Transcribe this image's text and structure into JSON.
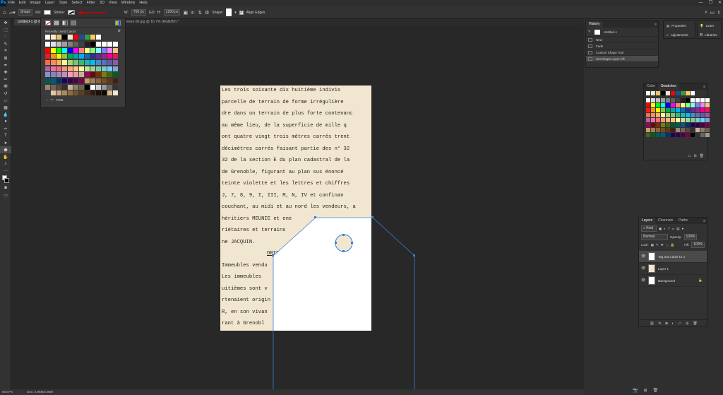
{
  "app": {
    "logo": "Ps"
  },
  "menu": [
    "File",
    "Edit",
    "Image",
    "Layer",
    "Type",
    "Select",
    "Filter",
    "3D",
    "View",
    "Window",
    "Help"
  ],
  "window_controls": [
    "—",
    "❐",
    "✕"
  ],
  "options": {
    "mode": "Shape",
    "fill_label": "Fill:",
    "stroke_label": "Stroke:",
    "w_label": "W:",
    "w_value": "750 px",
    "go_label": "GO",
    "h_label": "H:",
    "h_value": "1250 px",
    "shape_label": "Shape:",
    "align_edges": "Align Edges"
  },
  "tabs": [
    {
      "label": "Untitled-1 @ 66.7",
      "active": true
    },
    {
      "label": "annexe 60.jpg @ 16.7% (RGB/8#) *",
      "active": false
    }
  ],
  "picker": {
    "recent_label": "Recently Used Colors",
    "folder_label": "RGB",
    "recent": [
      "#ffffff",
      "#f6e9c9",
      "#e8c66b",
      "#000000",
      "#f1e7cf",
      "#ff0000",
      "#1f4e9c",
      "#2ea043",
      "#f8cf55",
      "#ffffff"
    ],
    "swatches": [
      "#ffffff",
      "#e0e0e0",
      "#c0c0c0",
      "#a0a0a0",
      "#808080",
      "#606060",
      "#404040",
      "#202020",
      "#000000",
      "#ffffff",
      "#ffffff",
      "#ffffff",
      "#ffffff",
      "#ff0000",
      "#ffff00",
      "#00ff00",
      "#00ffff",
      "#0000ff",
      "#ff00ff",
      "#ff8080",
      "#ffff80",
      "#80ff80",
      "#80ffff",
      "#8080ff",
      "#ff80ff",
      "#ffc080",
      "#ed1c24",
      "#f7941d",
      "#fff200",
      "#8dc63f",
      "#00a651",
      "#00a99d",
      "#00aeef",
      "#0072bc",
      "#2e3192",
      "#662d91",
      "#92278f",
      "#ec008c",
      "#ed145b",
      "#f26c4f",
      "#f68e56",
      "#fbaf5d",
      "#fff799",
      "#acd372",
      "#7cc576",
      "#3bb878",
      "#1abbb4",
      "#00bff3",
      "#448ccb",
      "#5674b9",
      "#605ca8",
      "#855fa8",
      "#a864a8",
      "#f06ea9",
      "#f26d7d",
      "#f7977a",
      "#f9ad81",
      "#fdc68a",
      "#fff79a",
      "#c4df9b",
      "#a3d39c",
      "#82ca9d",
      "#7bcdc8",
      "#6ecff6",
      "#7ea7d8",
      "#8493ca",
      "#8882be",
      "#a187be",
      "#bc8dbf",
      "#f49ac2",
      "#f6989d",
      "#c6b198",
      "#9e005d",
      "#790000",
      "#7b2e00",
      "#827b00",
      "#406618",
      "#005e20",
      "#005952",
      "#005b7f",
      "#003663",
      "#21005d",
      "#32004b",
      "#4b0049",
      "#7b0046",
      "#c69c6d",
      "#a67c52",
      "#8c6239",
      "#754c24",
      "#603913",
      "#42210b",
      "#998675",
      "#736357",
      "#534741",
      "#362f2d",
      "#c7b299",
      "#8b7e66",
      "#6e6352",
      "#000000",
      "#ffffff",
      "#cccccc",
      "#999999",
      "#666666",
      "#333333",
      "#3b3b3b",
      "#e2c8a8",
      "#c8a57a",
      "#ad8a5a",
      "#8f6d3e",
      "#735530",
      "#5a3e20",
      "#442c14",
      "#2f1c0a",
      "#1c0f04",
      "#0e0702",
      "#d5b98e",
      "#f1e7cf"
    ]
  },
  "document": {
    "lines": [
      "Les   trois soixante dix huitième indivis",
      "parcelle de terrain de forme irrégulière",
      "dre dans un terrain de plus forte contenanc",
      "au même lieu, de la superficie de mille q",
      "ont quatre vingt trois mètres carrés trent",
      "décimètres carrés faisant partie des n° 32",
      "32 de la section E du plan cadastral de la",
      "de Grenoble, figurant au plan sus énoncé",
      "teinte violette et les lettres et chiffres",
      "J, 7, 8, 9, I, III, M, N, IV et confinan",
      "couchant, au midi et au nord les vendeurs, a",
      "héritiers MEUNIE et ene",
      "riétaires et terrains",
      "ne JACQUIN.",
      "ORIG",
      "Immeubles vendu",
      "Les immeubles",
      "uitièmes sont v",
      "rtenaient origin",
      "R, en son vivan",
      "rant à Grenobl"
    ]
  },
  "status": {
    "zoom": "66.67%",
    "doc": "Doc: 2.96M/2.96M"
  },
  "history": {
    "tab": "History",
    "snapshot": "Untitled-1",
    "items": [
      "New",
      "Fade",
      "Custom Shape Tool",
      "Set Shape Layer Fill"
    ]
  },
  "props": {
    "properties": "Properties",
    "adjustments": "Adjustments",
    "learn": "Learn",
    "libraries": "Libraries"
  },
  "swatches_panel": {
    "tabs": [
      "Color",
      "Swatches"
    ],
    "colors": [
      "#ffffff",
      "#e0e0e0",
      "#c0c0c0",
      "#a0a0a0",
      "#808080",
      "#606060",
      "#404040",
      "#202020",
      "#000000",
      "#ffffff",
      "#ffffff",
      "#ffffff",
      "#ffffff",
      "#ff0000",
      "#ffff00",
      "#00ff00",
      "#00ffff",
      "#0000ff",
      "#ff00ff",
      "#ff8080",
      "#ffff80",
      "#80ff80",
      "#80ffff",
      "#8080ff",
      "#ff80ff",
      "#ffc080",
      "#ed1c24",
      "#f7941d",
      "#fff200",
      "#8dc63f",
      "#00a651",
      "#00a99d",
      "#00aeef",
      "#0072bc",
      "#2e3192",
      "#662d91",
      "#92278f",
      "#ec008c",
      "#ed145b",
      "#f26c4f",
      "#f68e56",
      "#fbaf5d",
      "#fff799",
      "#acd372",
      "#7cc576",
      "#3bb878",
      "#1abbb4",
      "#00bff3",
      "#448ccb",
      "#5674b9",
      "#605ca8",
      "#855fa8",
      "#a864a8",
      "#f06ea9",
      "#f26d7d",
      "#f7977a",
      "#f9ad81",
      "#fdc68a",
      "#fff79a",
      "#c4df9b",
      "#a3d39c",
      "#82ca9d",
      "#7bcdc8",
      "#6ecff6",
      "#7ea7d8",
      "#9e005d",
      "#790000",
      "#7b2e00",
      "#827b00",
      "#406618",
      "#005e20",
      "#005952",
      "#005b7f",
      "#003663",
      "#21005d",
      "#32004b",
      "#4b0049",
      "#7b0046",
      "#c69c6d",
      "#a67c52",
      "#8c6239",
      "#754c24",
      "#603913",
      "#42210b",
      "#998675",
      "#736357",
      "#534741",
      "#362f2d",
      "#c7b299",
      "#8b7e66",
      "#6e6352",
      "#406618",
      "#005e20",
      "#005952",
      "#005b7f",
      "#003663",
      "#21005d",
      "#32004b",
      "#4b0049",
      "#7b0046",
      "#000000",
      "#333333",
      "#666666",
      "#999999"
    ]
  },
  "layers": {
    "tabs": [
      "Layers",
      "Channels",
      "Paths"
    ],
    "kind": "Kind",
    "blend": "Normal",
    "opacity_label": "Opacity:",
    "opacity": "100%",
    "lock_label": "Lock:",
    "fill_label": "Fill:",
    "fill": "100%",
    "items": [
      {
        "name": "Tag and Label 12 1",
        "selected": true
      },
      {
        "name": "Layer 1",
        "selected": false
      },
      {
        "name": "Background",
        "selected": false
      }
    ]
  }
}
